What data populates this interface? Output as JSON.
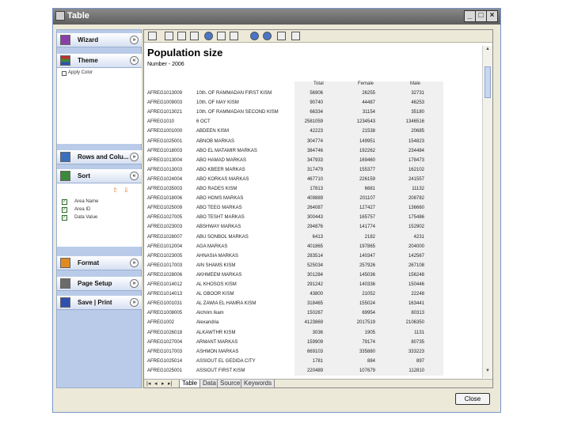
{
  "window": {
    "title": "Table"
  },
  "sidebar": {
    "sections": [
      {
        "label": "Wizard",
        "chev": "»"
      },
      {
        "label": "Theme",
        "chev": "«",
        "link": "Apply Color"
      },
      {
        "label": "Rows and Colu...",
        "chev": "»"
      },
      {
        "label": "Sort",
        "chev": "«"
      },
      {
        "label": "Format",
        "chev": "»"
      },
      {
        "label": "Page Setup",
        "chev": "»"
      },
      {
        "label": "Save | Print",
        "chev": "»"
      }
    ],
    "sort_items": [
      "Area Name",
      "Area ID",
      "Data Value"
    ]
  },
  "document": {
    "title": "Population size",
    "subtitle": "Number - 2006",
    "columns": {
      "total": "Total",
      "female": "Female",
      "male": "Male"
    },
    "rows": [
      [
        "AFREG1013009",
        "10th. OF RAMMADAN FIRST KISM",
        "56906",
        "26255",
        "32731"
      ],
      [
        "AFREG1009003",
        "10th. OF MAY KISM",
        "90740",
        "44487",
        "46253"
      ],
      [
        "AFREG1013021",
        "10th. OF RAMMADAN SECOND KISM",
        "66334",
        "31154",
        "35180"
      ],
      [
        "AFREG1010",
        "6 OCT",
        "2581059",
        "1234543",
        "1346516"
      ],
      [
        "AFREG1001000",
        "ABDEEN KISM",
        "42223",
        "21538",
        "20685"
      ],
      [
        "AFREG1025001",
        "ABNOB MARKAS",
        "304774",
        "149951",
        "154823"
      ],
      [
        "AFREG1018003",
        "ABO EL MATAMIR MARKAS",
        "384746",
        "192262",
        "234484"
      ],
      [
        "AFREG1013004",
        "ABO HAMAD MARKAS",
        "347933",
        "169460",
        "178473"
      ],
      [
        "AFREG1013003",
        "ABO KBEER MARKAS",
        "317479",
        "155377",
        "162102"
      ],
      [
        "AFREG1024004",
        "ABO KORKAS MARKAS",
        "467710",
        "226159",
        "241557"
      ],
      [
        "AFREG1035003",
        "ABO RADES KISM",
        "17813",
        "6681",
        "11132"
      ],
      [
        "AFREG1018006",
        "ABO HOMS MARKAS",
        "409889",
        "201107",
        "208782"
      ],
      [
        "AFREG1025009",
        "ABO TEEG MARKAS",
        "264087",
        "127427",
        "136660"
      ],
      [
        "AFREG1027005",
        "ABO TESHT MARKAS",
        "300443",
        "165757",
        "175486"
      ],
      [
        "AFREG1023003",
        "ABSHWAY MARKAS",
        "294876",
        "141774",
        "152902"
      ],
      [
        "AFREG1028007",
        "ABU SONBOL MARKAS",
        "6413",
        "2182",
        "4231"
      ],
      [
        "AFREG1012004",
        "AGA MARKAS",
        "401865",
        "197865",
        "204000"
      ],
      [
        "AFREG1023005",
        "AHNASIA MARKAS",
        "283514",
        "140347",
        "142567"
      ],
      [
        "AFREG1017003",
        "AIN SHAMS KISM",
        "525034",
        "257926",
        "267108"
      ],
      [
        "AFREG1028006",
        "AKHMEEM MARKAS",
        "301284",
        "145036",
        "156248"
      ],
      [
        "AFREG1014012",
        "AL KHOSOS KISM",
        "291242",
        "140336",
        "150446"
      ],
      [
        "AFREG1014013",
        "AL OBOOR KISM",
        "43800",
        "21052",
        "22248"
      ],
      [
        "AFREG1001031",
        "AL ZAWIA EL HAMRA KISM",
        "318465",
        "155024",
        "163441"
      ],
      [
        "AFREG1008005",
        "Alchrim Ikam",
        "150267",
        "69954",
        "80313"
      ],
      [
        "AFREG1002",
        "Alexandria",
        "4123869",
        "2017519",
        "2106350"
      ],
      [
        "AFREG1026018",
        "ALKAWTHR KISM",
        "3036",
        "1905",
        "1131"
      ],
      [
        "AFREG1027004",
        "ARMANT MARKAS",
        "159909",
        "79174",
        "80735"
      ],
      [
        "AFREG1017003",
        "ASHMON MARKAS",
        "669103",
        "335880",
        "333223"
      ],
      [
        "AFREG1025014",
        "ASSIOUT EL GEDIDA CITY",
        "1781",
        "884",
        "897"
      ],
      [
        "AFREG1025001",
        "ASSIOUT FIRST KISM",
        "220489",
        "107679",
        "112810"
      ]
    ],
    "tabs": [
      "Table",
      "Data",
      "Source",
      "Keywords"
    ],
    "nav": [
      "|◂",
      "◂",
      "▸",
      "▸|"
    ]
  },
  "footer": {
    "close_label": "Close"
  }
}
